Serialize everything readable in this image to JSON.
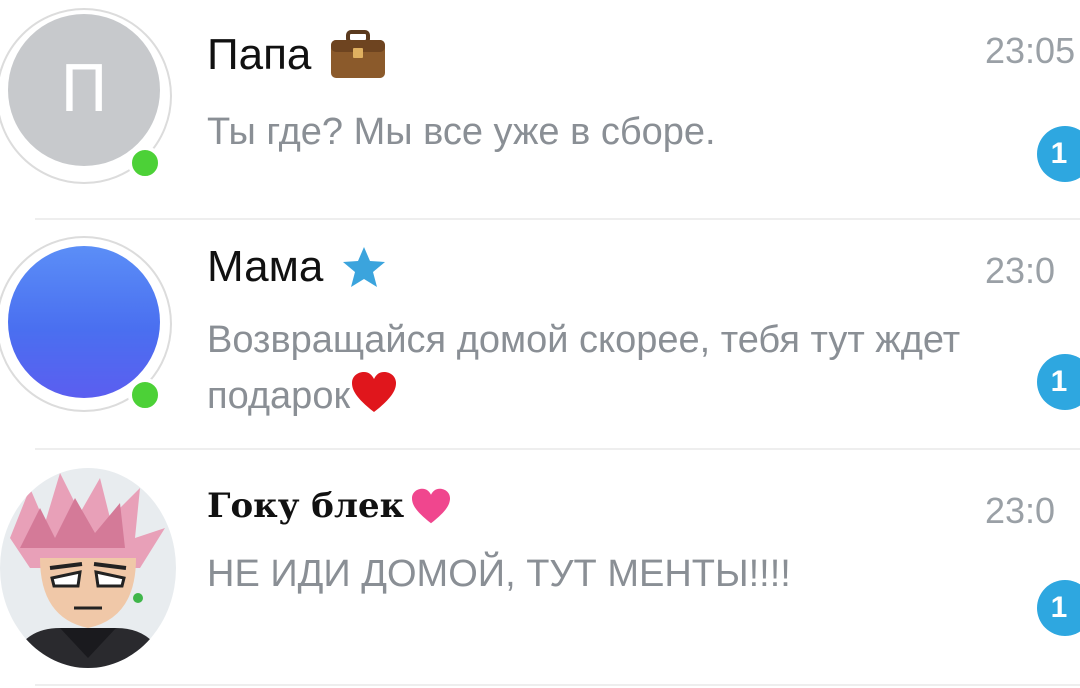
{
  "chats": [
    {
      "avatar_initial": "П",
      "name": "Папа",
      "name_icon": "briefcase-icon",
      "message": "Ты где? Мы все уже в сборе.",
      "time": "23:05",
      "unread": "1",
      "online": true
    },
    {
      "name": "Мама",
      "name_icon": "star-icon",
      "message": "Возвращайся домой скорее, тебя тут ждет подарок",
      "message_icon": "red-heart-icon",
      "time": "23:0",
      "unread": "1",
      "online": true
    },
    {
      "name": "Гоку блек",
      "name_icon": "pink-heart-icon",
      "message": "НЕ ИДИ ДОМОЙ, ТУТ МЕНТЫ!!!!",
      "time": "23:0",
      "unread": "1",
      "online": false
    }
  ],
  "colors": {
    "online": "#4cd137",
    "badge": "#2ea7e0",
    "message_text": "#8a8f95",
    "avatar_gray": "#c7c9cc",
    "avatar_blue": "#4a6ff0"
  }
}
